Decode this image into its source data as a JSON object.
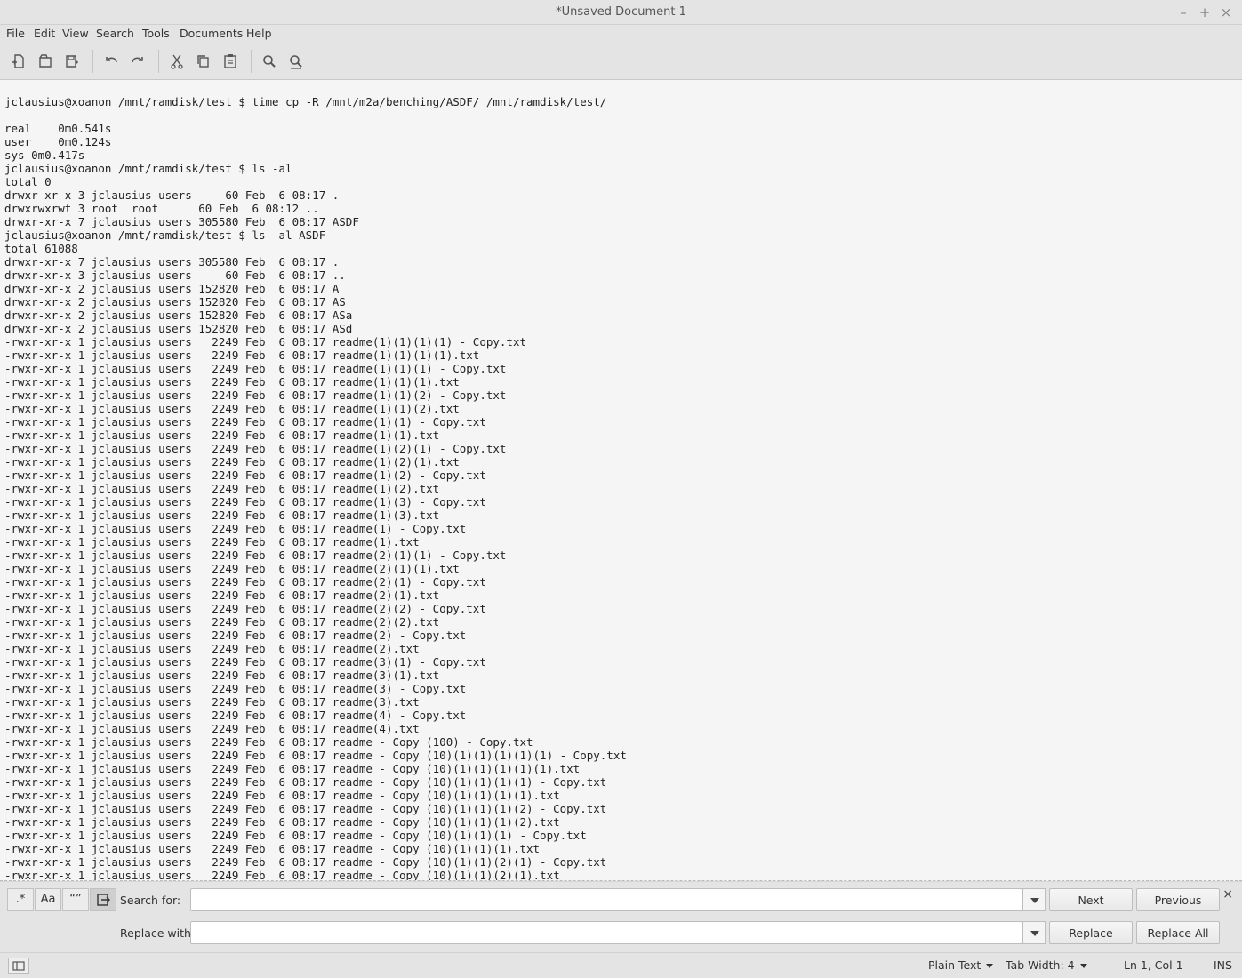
{
  "window": {
    "title": "*Unsaved Document 1"
  },
  "menu": [
    "File",
    "Edit",
    "View",
    "Search",
    "Tools",
    "Documents",
    "Help"
  ],
  "toolbar_icons": [
    "new-document-icon",
    "open-icon",
    "save-icon",
    "undo-icon",
    "redo-icon",
    "cut-icon",
    "copy-icon",
    "paste-icon",
    "find-icon",
    "find-replace-icon"
  ],
  "editor": {
    "lines": [
      "jclausius@xoanon /mnt/ramdisk/test $ time cp -R /mnt/m2a/benching/ASDF/ /mnt/ramdisk/test/",
      "",
      "real    0m0.541s",
      "user    0m0.124s",
      "sys 0m0.417s",
      "jclausius@xoanon /mnt/ramdisk/test $ ls -al",
      "total 0",
      "drwxr-xr-x 3 jclausius users     60 Feb  6 08:17 .",
      "drwxrwxrwt 3 root  root      60 Feb  6 08:12 ..",
      "drwxr-xr-x 7 jclausius users 305580 Feb  6 08:17 ASDF",
      "jclausius@xoanon /mnt/ramdisk/test $ ls -al ASDF",
      "total 61088",
      "drwxr-xr-x 7 jclausius users 305580 Feb  6 08:17 .",
      "drwxr-xr-x 3 jclausius users     60 Feb  6 08:17 ..",
      "drwxr-xr-x 2 jclausius users 152820 Feb  6 08:17 A",
      "drwxr-xr-x 2 jclausius users 152820 Feb  6 08:17 AS",
      "drwxr-xr-x 2 jclausius users 152820 Feb  6 08:17 ASa",
      "drwxr-xr-x 2 jclausius users 152820 Feb  6 08:17 ASd",
      "-rwxr-xr-x 1 jclausius users   2249 Feb  6 08:17 readme(1)(1)(1)(1) - Copy.txt",
      "-rwxr-xr-x 1 jclausius users   2249 Feb  6 08:17 readme(1)(1)(1)(1).txt",
      "-rwxr-xr-x 1 jclausius users   2249 Feb  6 08:17 readme(1)(1)(1) - Copy.txt",
      "-rwxr-xr-x 1 jclausius users   2249 Feb  6 08:17 readme(1)(1)(1).txt",
      "-rwxr-xr-x 1 jclausius users   2249 Feb  6 08:17 readme(1)(1)(2) - Copy.txt",
      "-rwxr-xr-x 1 jclausius users   2249 Feb  6 08:17 readme(1)(1)(2).txt",
      "-rwxr-xr-x 1 jclausius users   2249 Feb  6 08:17 readme(1)(1) - Copy.txt",
      "-rwxr-xr-x 1 jclausius users   2249 Feb  6 08:17 readme(1)(1).txt",
      "-rwxr-xr-x 1 jclausius users   2249 Feb  6 08:17 readme(1)(2)(1) - Copy.txt",
      "-rwxr-xr-x 1 jclausius users   2249 Feb  6 08:17 readme(1)(2)(1).txt",
      "-rwxr-xr-x 1 jclausius users   2249 Feb  6 08:17 readme(1)(2) - Copy.txt",
      "-rwxr-xr-x 1 jclausius users   2249 Feb  6 08:17 readme(1)(2).txt",
      "-rwxr-xr-x 1 jclausius users   2249 Feb  6 08:17 readme(1)(3) - Copy.txt",
      "-rwxr-xr-x 1 jclausius users   2249 Feb  6 08:17 readme(1)(3).txt",
      "-rwxr-xr-x 1 jclausius users   2249 Feb  6 08:17 readme(1) - Copy.txt",
      "-rwxr-xr-x 1 jclausius users   2249 Feb  6 08:17 readme(1).txt",
      "-rwxr-xr-x 1 jclausius users   2249 Feb  6 08:17 readme(2)(1)(1) - Copy.txt",
      "-rwxr-xr-x 1 jclausius users   2249 Feb  6 08:17 readme(2)(1)(1).txt",
      "-rwxr-xr-x 1 jclausius users   2249 Feb  6 08:17 readme(2)(1) - Copy.txt",
      "-rwxr-xr-x 1 jclausius users   2249 Feb  6 08:17 readme(2)(1).txt",
      "-rwxr-xr-x 1 jclausius users   2249 Feb  6 08:17 readme(2)(2) - Copy.txt",
      "-rwxr-xr-x 1 jclausius users   2249 Feb  6 08:17 readme(2)(2).txt",
      "-rwxr-xr-x 1 jclausius users   2249 Feb  6 08:17 readme(2) - Copy.txt",
      "-rwxr-xr-x 1 jclausius users   2249 Feb  6 08:17 readme(2).txt",
      "-rwxr-xr-x 1 jclausius users   2249 Feb  6 08:17 readme(3)(1) - Copy.txt",
      "-rwxr-xr-x 1 jclausius users   2249 Feb  6 08:17 readme(3)(1).txt",
      "-rwxr-xr-x 1 jclausius users   2249 Feb  6 08:17 readme(3) - Copy.txt",
      "-rwxr-xr-x 1 jclausius users   2249 Feb  6 08:17 readme(3).txt",
      "-rwxr-xr-x 1 jclausius users   2249 Feb  6 08:17 readme(4) - Copy.txt",
      "-rwxr-xr-x 1 jclausius users   2249 Feb  6 08:17 readme(4).txt",
      "-rwxr-xr-x 1 jclausius users   2249 Feb  6 08:17 readme - Copy (100) - Copy.txt",
      "-rwxr-xr-x 1 jclausius users   2249 Feb  6 08:17 readme - Copy (10)(1)(1)(1)(1)(1) - Copy.txt",
      "-rwxr-xr-x 1 jclausius users   2249 Feb  6 08:17 readme - Copy (10)(1)(1)(1)(1)(1).txt",
      "-rwxr-xr-x 1 jclausius users   2249 Feb  6 08:17 readme - Copy (10)(1)(1)(1)(1) - Copy.txt",
      "-rwxr-xr-x 1 jclausius users   2249 Feb  6 08:17 readme - Copy (10)(1)(1)(1)(1).txt",
      "-rwxr-xr-x 1 jclausius users   2249 Feb  6 08:17 readme - Copy (10)(1)(1)(1)(2) - Copy.txt",
      "-rwxr-xr-x 1 jclausius users   2249 Feb  6 08:17 readme - Copy (10)(1)(1)(1)(2).txt",
      "-rwxr-xr-x 1 jclausius users   2249 Feb  6 08:17 readme - Copy (10)(1)(1)(1) - Copy.txt",
      "-rwxr-xr-x 1 jclausius users   2249 Feb  6 08:17 readme - Copy (10)(1)(1)(1).txt",
      "-rwxr-xr-x 1 jclausius users   2249 Feb  6 08:17 readme - Copy (10)(1)(1)(2)(1) - Copy.txt",
      "-rwxr-xr-x 1 jclausius users   2249 Feb  6 08:17 readme - Copy (10)(1)(1)(2)(1).txt"
    ]
  },
  "search": {
    "regex_label": ".*",
    "case_label": "Aa",
    "whole_word_label": "“”",
    "search_for_label": "Search for:",
    "search_value": "",
    "next_label": "Next",
    "previous_label": "Previous",
    "replace_with_label": "Replace with:",
    "replace_value": "",
    "replace_label": "Replace",
    "replace_all_label": "Replace All",
    "close_glyph": "×"
  },
  "status": {
    "syntax": "Plain Text",
    "tab_width": "Tab Width:  4",
    "cursor": "Ln 1, Col 1",
    "mode": "INS"
  }
}
